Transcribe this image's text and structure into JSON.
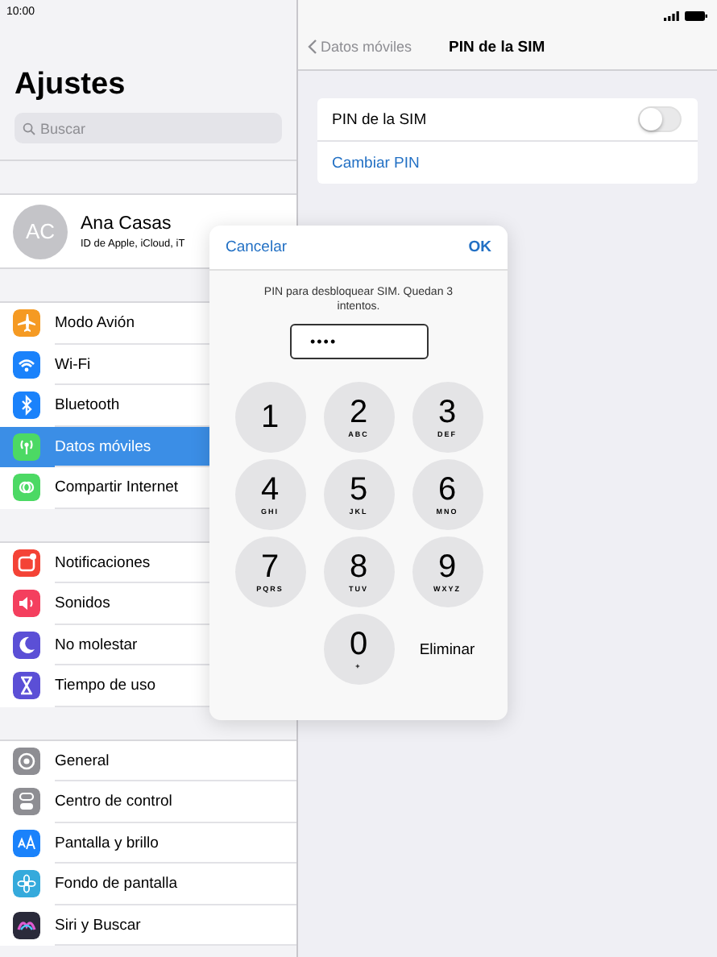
{
  "status_bar": {
    "time": "10:00"
  },
  "sidebar": {
    "title": "Ajustes",
    "search": {
      "placeholder": "Buscar"
    },
    "profile": {
      "initials": "AC",
      "name": "Ana Casas",
      "subtitle": "ID de Apple, iCloud, iT"
    },
    "groups": [
      [
        {
          "label": "Modo Avión",
          "color": "#f59a23",
          "selected": false
        },
        {
          "label": "Wi-Fi",
          "color": "#1a82fb",
          "selected": false
        },
        {
          "label": "Bluetooth",
          "color": "#1a82fb",
          "selected": false
        },
        {
          "label": "Datos móviles",
          "color": "#4cd964",
          "selected": true
        },
        {
          "label": "Compartir Internet",
          "color": "#4cd964",
          "selected": false
        }
      ],
      [
        {
          "label": "Notificaciones",
          "color": "#f44336",
          "selected": false
        },
        {
          "label": "Sonidos",
          "color": "#f43f5e",
          "selected": false
        },
        {
          "label": "No molestar",
          "color": "#5b4fd6",
          "selected": false
        },
        {
          "label": "Tiempo de uso",
          "color": "#5b4fd6",
          "selected": false
        }
      ],
      [
        {
          "label": "General",
          "color": "#8e8e93",
          "selected": false
        },
        {
          "label": "Centro de control",
          "color": "#8e8e93",
          "selected": false
        },
        {
          "label": "Pantalla y brillo",
          "color": "#1a82fb",
          "selected": false
        },
        {
          "label": "Fondo de pantalla",
          "color": "#35aadc",
          "selected": false
        },
        {
          "label": "Siri y Buscar",
          "color": "#2a2a3a",
          "selected": false
        }
      ]
    ]
  },
  "detail": {
    "back": "Datos móviles",
    "title": "PIN de la SIM",
    "rows": [
      {
        "kind": "toggle",
        "label": "PIN de la SIM",
        "on": false
      },
      {
        "kind": "link",
        "label": "Cambiar PIN"
      }
    ]
  },
  "dialog": {
    "cancel": "Cancelar",
    "ok": "OK",
    "message": "PIN para desbloquear SIM. Quedan 3 intentos.",
    "pin": {
      "value": "••••"
    },
    "keys": [
      {
        "kind": "digit",
        "digit": "1"
      },
      {
        "kind": "digit",
        "digit": "2",
        "letters": "ABC"
      },
      {
        "kind": "digit",
        "digit": "3",
        "letters": "DEF"
      },
      {
        "kind": "digit",
        "digit": "4",
        "letters": "GHI"
      },
      {
        "kind": "digit",
        "digit": "5",
        "letters": "JKL"
      },
      {
        "kind": "digit",
        "digit": "6",
        "letters": "MNO"
      },
      {
        "kind": "digit",
        "digit": "7",
        "letters": "PQRS"
      },
      {
        "kind": "digit",
        "digit": "8",
        "letters": "TUV"
      },
      {
        "kind": "digit",
        "digit": "9",
        "letters": "WXYZ"
      },
      {
        "kind": "digit",
        "digit": "0",
        "letters": "+"
      },
      {
        "kind": "delete",
        "label": "Eliminar"
      }
    ]
  }
}
